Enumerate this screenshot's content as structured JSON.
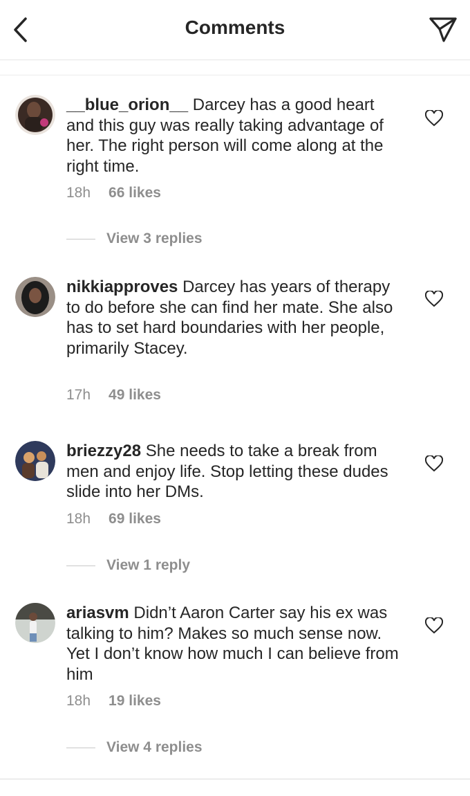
{
  "header": {
    "title": "Comments",
    "back_icon": "chevron-left-icon",
    "share_icon": "paper-plane-icon"
  },
  "comments": [
    {
      "username": "__blue_orion__",
      "text": " Darcey has a good heart and this guy was really taking advantage of her. The right person will come along at the right time.",
      "time": "18h",
      "likes": "66 likes",
      "replies": "View 3 replies",
      "avatar_colors": [
        "#3a2a24",
        "#c23a7a"
      ]
    },
    {
      "username": "nikkiapproves",
      "text": " Darcey has years of therapy to do before she can find her mate. She also has to set hard boundaries with her people, primarily Stacey.",
      "time": "17h",
      "likes": "49 likes",
      "replies": "",
      "avatar_colors": [
        "#1c1c1c",
        "#9a8f86"
      ]
    },
    {
      "username": "briezzy28",
      "text": " She needs to take a break from men and enjoy life. Stop letting these dudes slide into her DMs.",
      "time": "18h",
      "likes": "69 likes",
      "replies": "View 1 reply",
      "avatar_colors": [
        "#5a3b2c",
        "#d9a26a"
      ]
    },
    {
      "username": "ariasvm",
      "text": " Didn’t Aaron Carter say his ex was talking to him? Makes so much sense now. Yet I don’t know how much I can believe from him",
      "time": "18h",
      "likes": "19 likes",
      "replies": "View 4 replies",
      "avatar_colors": [
        "#4a4a44",
        "#cfd4cf"
      ]
    }
  ]
}
